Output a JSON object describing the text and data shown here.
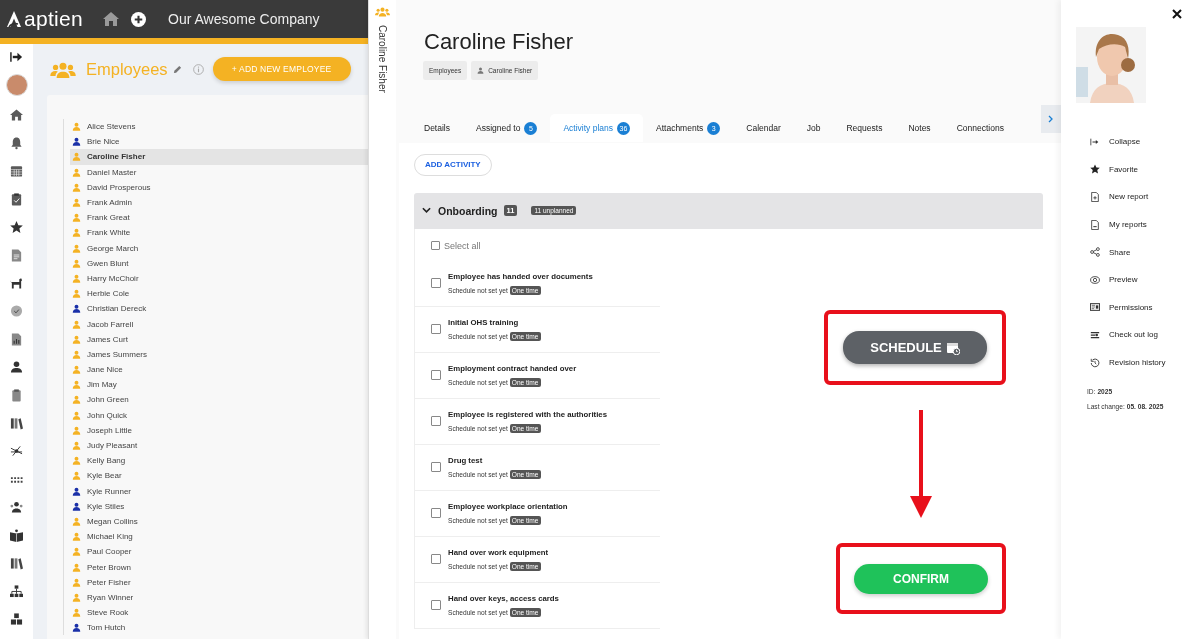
{
  "top_bar": {
    "logo": "aptien",
    "company": "Our Awesome Company"
  },
  "page_header": {
    "title": "Employees",
    "add_button": "+ ADD NEW EMPLOYEE"
  },
  "employees": [
    {
      "name": "Alice Stevens",
      "color": "#f4b223",
      "selected": false
    },
    {
      "name": "Brie Nice",
      "color": "#1a30a8",
      "selected": false
    },
    {
      "name": "Caroline Fisher",
      "color": "#f4b223",
      "selected": true
    },
    {
      "name": "Daniel Master",
      "color": "#f4b223",
      "selected": false
    },
    {
      "name": "David Prosperous",
      "color": "#f4b223",
      "selected": false
    },
    {
      "name": "Frank Admin",
      "color": "#f4b223",
      "selected": false
    },
    {
      "name": "Frank Great",
      "color": "#f4b223",
      "selected": false
    },
    {
      "name": "Frank White",
      "color": "#f4b223",
      "selected": false
    },
    {
      "name": "George March",
      "color": "#f4b223",
      "selected": false
    },
    {
      "name": "Gwen Blunt",
      "color": "#f4b223",
      "selected": false
    },
    {
      "name": "Harry McChoir",
      "color": "#f4b223",
      "selected": false
    },
    {
      "name": "Herbie Cole",
      "color": "#f4b223",
      "selected": false
    },
    {
      "name": "Christian Dereck",
      "color": "#1a30a8",
      "selected": false
    },
    {
      "name": "Jacob Farrell",
      "color": "#f4b223",
      "selected": false
    },
    {
      "name": "James Curt",
      "color": "#f4b223",
      "selected": false
    },
    {
      "name": "James Summers",
      "color": "#f4b223",
      "selected": false
    },
    {
      "name": "Jane Nice",
      "color": "#f4b223",
      "selected": false
    },
    {
      "name": "Jim May",
      "color": "#f4b223",
      "selected": false
    },
    {
      "name": "John Green",
      "color": "#f4b223",
      "selected": false
    },
    {
      "name": "John Quick",
      "color": "#f4b223",
      "selected": false
    },
    {
      "name": "Joseph Little",
      "color": "#f4b223",
      "selected": false
    },
    {
      "name": "Judy Pleasant",
      "color": "#f4b223",
      "selected": false
    },
    {
      "name": "Kelly Bang",
      "color": "#f4b223",
      "selected": false
    },
    {
      "name": "Kyle Bear",
      "color": "#f4b223",
      "selected": false
    },
    {
      "name": "Kyle Runner",
      "color": "#1a30a8",
      "selected": false
    },
    {
      "name": "Kyle Stiles",
      "color": "#1a30a8",
      "selected": false
    },
    {
      "name": "Megan Collins",
      "color": "#f4b223",
      "selected": false
    },
    {
      "name": "Michael King",
      "color": "#f4b223",
      "selected": false
    },
    {
      "name": "Paul Cooper",
      "color": "#f4b223",
      "selected": false
    },
    {
      "name": "Peter Brown",
      "color": "#f4b223",
      "selected": false
    },
    {
      "name": "Peter Fisher",
      "color": "#f4b223",
      "selected": false
    },
    {
      "name": "Ryan Winner",
      "color": "#f4b223",
      "selected": false
    },
    {
      "name": "Steve Rook",
      "color": "#f4b223",
      "selected": false
    },
    {
      "name": "Tom Hutch",
      "color": "#1a30a8",
      "selected": false
    }
  ],
  "side_tab": {
    "label": "Caroline Fisher"
  },
  "detail": {
    "title": "Caroline Fisher",
    "breadcrumbs": [
      {
        "label": "Employees",
        "kind": "text"
      },
      {
        "label": "Caroline Fisher",
        "kind": "person"
      }
    ],
    "tabs": [
      {
        "label": "Details",
        "selected": false
      },
      {
        "label": "Assigned to",
        "count": "5",
        "selected": false
      },
      {
        "label": "Activity plans",
        "count": "36",
        "selected": true
      },
      {
        "label": "Attachments",
        "count": "3",
        "selected": false
      },
      {
        "label": "Calendar",
        "selected": false
      },
      {
        "label": "Job",
        "selected": false
      },
      {
        "label": "Requests",
        "selected": false
      },
      {
        "label": "Notes",
        "selected": false
      },
      {
        "label": "Connections",
        "selected": false
      }
    ],
    "add_activity": "ADD ACTIVITY",
    "group": {
      "title": "Onboarding",
      "count": "11",
      "badge": "11 unplanned",
      "expanded": true,
      "select_all": {
        "label": "Select all",
        "checked": false
      },
      "items": [
        {
          "title": "Employee has handed over documents",
          "schedule": "Schedule not set yet",
          "badge": "One time",
          "checked": false
        },
        {
          "title": "Initial OHS training",
          "schedule": "Schedule not set yet",
          "badge": "One time",
          "checked": false
        },
        {
          "title": "Employment contract handed over",
          "schedule": "Schedule not set yet",
          "badge": "One time",
          "checked": false
        },
        {
          "title": "Employee is registered with the authorities",
          "schedule": "Schedule not set yet",
          "badge": "One time",
          "checked": false
        },
        {
          "title": "Drug test",
          "schedule": "Schedule not set yet",
          "badge": "One time",
          "checked": false
        },
        {
          "title": "Employee workplace orientation",
          "schedule": "Schedule not set yet",
          "badge": "One time",
          "checked": false
        },
        {
          "title": "Hand over work equipment",
          "schedule": "Schedule not set yet",
          "badge": "One time",
          "checked": false
        },
        {
          "title": "Hand over keys, access cards",
          "schedule": "Schedule not set yet",
          "badge": "One time",
          "checked": false
        }
      ]
    },
    "schedule_button": "SCHEDULE",
    "confirm_button": "CONFIRM"
  },
  "side_menu": {
    "items": [
      {
        "label": "Collapse",
        "kind": "collapse"
      },
      {
        "label": "Favorite",
        "kind": "star"
      },
      {
        "label": "New report",
        "kind": "new-report"
      },
      {
        "label": "My reports",
        "kind": "report"
      },
      {
        "label": "Share",
        "kind": "share"
      },
      {
        "label": "Preview",
        "kind": "eye"
      },
      {
        "label": "Permissions",
        "kind": "card"
      },
      {
        "label": "Check out log",
        "kind": "log"
      },
      {
        "label": "Revision history",
        "kind": "history"
      }
    ],
    "id_label": "ID:",
    "id": "2025",
    "last_change_label": "Last change:",
    "last_change": "05. 08. 2025"
  }
}
